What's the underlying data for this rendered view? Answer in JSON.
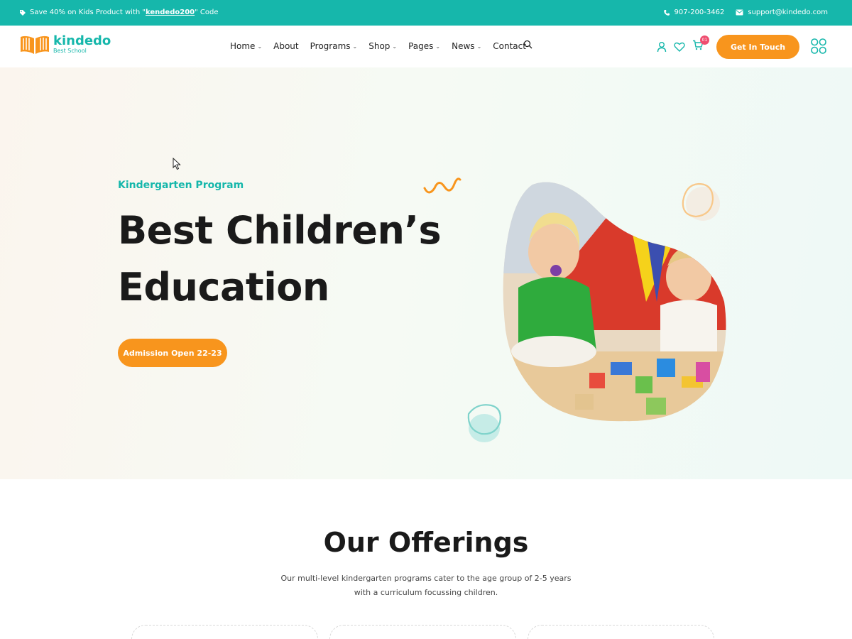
{
  "topbar": {
    "promo_prefix": "Save 40% on Kids Product with \"",
    "promo_code": "kendedo200",
    "promo_suffix": "\" Code",
    "phone": "907-200-3462",
    "email": "support@kindedo.com"
  },
  "header": {
    "logo_name": "kindedo",
    "logo_tag": "Best School",
    "nav": [
      {
        "label": "Home",
        "has_dropdown": true
      },
      {
        "label": "About",
        "has_dropdown": false
      },
      {
        "label": "Programs",
        "has_dropdown": true
      },
      {
        "label": "Shop",
        "has_dropdown": true
      },
      {
        "label": "Pages",
        "has_dropdown": true
      },
      {
        "label": "News",
        "has_dropdown": true
      },
      {
        "label": "Contact",
        "has_dropdown": false
      }
    ],
    "cart_count": "01",
    "cta_label": "Get In Touch"
  },
  "hero": {
    "eyebrow": "Kindergarten Program",
    "title_line1": "Best Children’s",
    "title_line2": "Education",
    "button_label": "Admission Open 22-23"
  },
  "offerings": {
    "title": "Our Offerings",
    "desc_line1": "Our multi-level kindergarten programs cater to the age group of 2-5 years",
    "desc_line2": "with a curriculum focussing children."
  },
  "colors": {
    "accent_teal": "#16b7ab",
    "accent_orange": "#f8951d",
    "badge_pink": "#ef4d6f"
  },
  "icons": [
    "tag-icon",
    "phone-icon",
    "mail-icon",
    "search-icon",
    "user-icon",
    "heart-icon",
    "cart-icon",
    "grid-menu-icon"
  ]
}
